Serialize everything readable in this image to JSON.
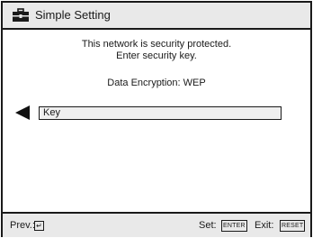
{
  "window": {
    "title": "Simple Setting",
    "title_icon": "toolbox-icon"
  },
  "message": {
    "line1": "This network is security protected.",
    "line2": "Enter security key."
  },
  "encryption": {
    "text": "Data Encryption:  WEP"
  },
  "key_field": {
    "label": "Key",
    "arrow_icon": "left-triangle-icon"
  },
  "footer": {
    "prev_label": "Prev.:",
    "prev_icon_glyph": "↵",
    "set_label": "Set:",
    "set_key": "ENTER",
    "exit_label": "Exit:",
    "exit_key": "RESET"
  }
}
